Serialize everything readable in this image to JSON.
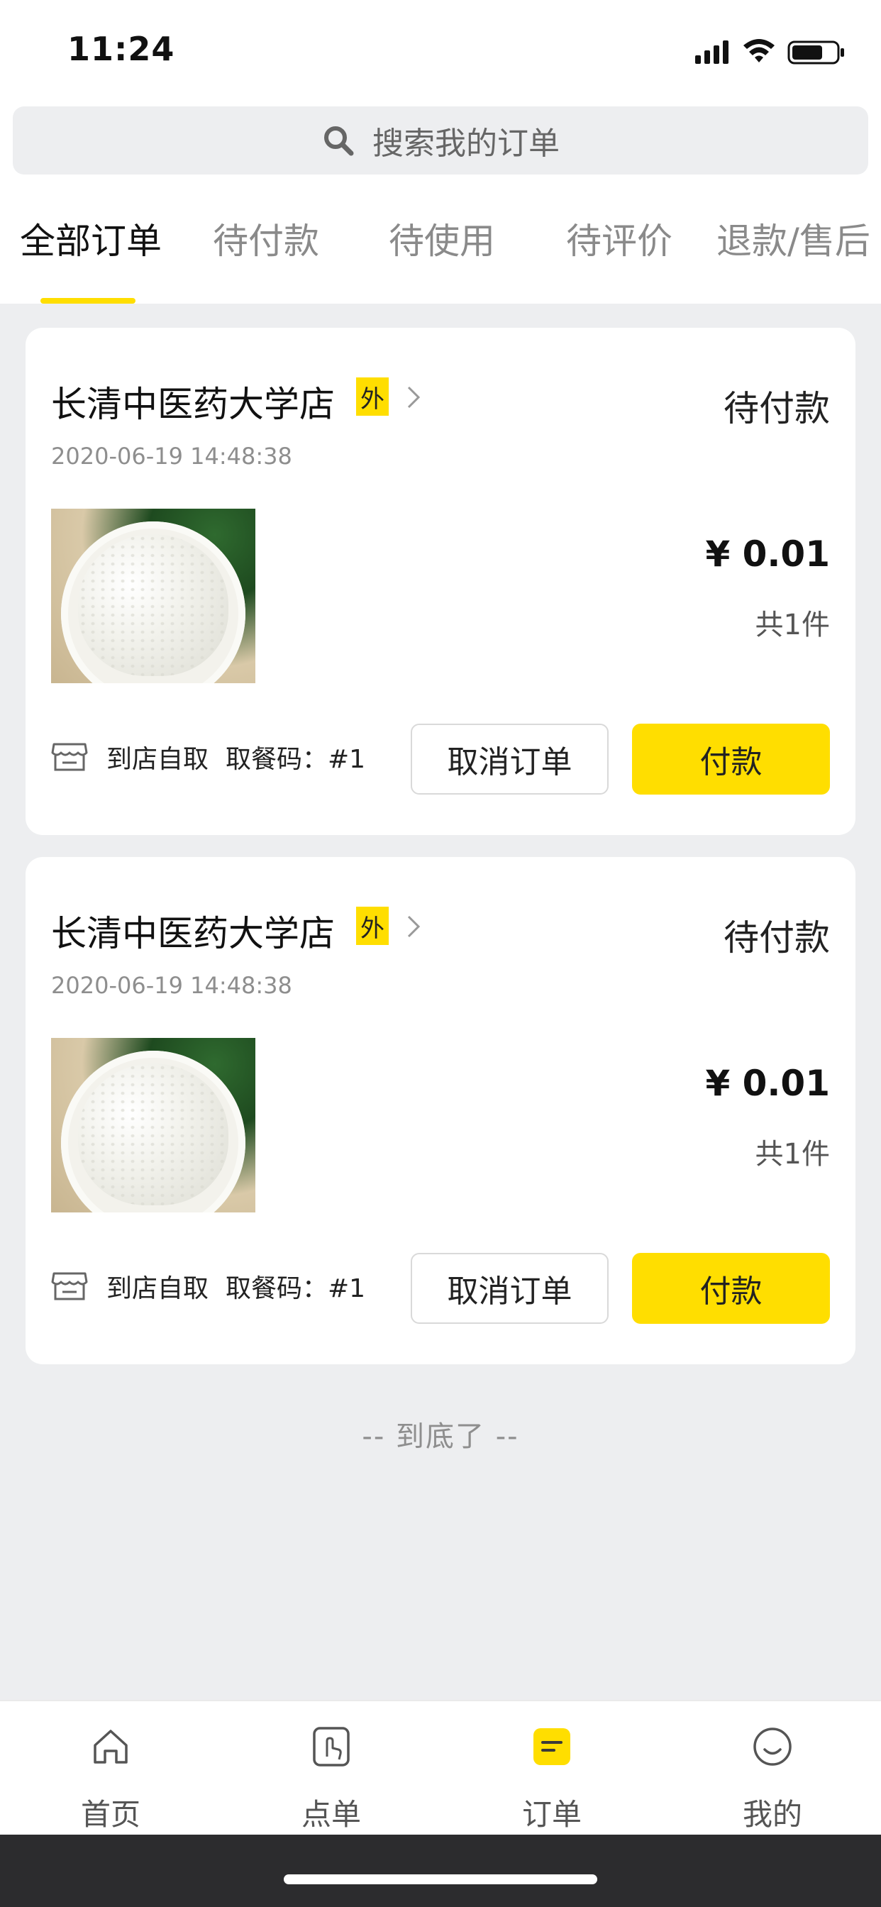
{
  "status_bar": {
    "time": "11:24"
  },
  "search": {
    "placeholder": "搜索我的订单"
  },
  "tabs": [
    {
      "label": "全部订单",
      "active": true
    },
    {
      "label": "待付款",
      "active": false
    },
    {
      "label": "待使用",
      "active": false
    },
    {
      "label": "待评价",
      "active": false
    },
    {
      "label": "退款/售后",
      "active": false
    }
  ],
  "orders": [
    {
      "store": "长清中医药大学店",
      "badge": "外",
      "status": "待付款",
      "date": "2020-06-19 14:48:38",
      "price": "¥ 0.01",
      "count": "共1件",
      "pickup": "到店自取",
      "code": "取餐码：#1",
      "cancel_label": "取消订单",
      "pay_label": "付款"
    },
    {
      "store": "长清中医药大学店",
      "badge": "外",
      "status": "待付款",
      "date": "2020-06-19 14:48:38",
      "price": "¥ 0.01",
      "count": "共1件",
      "pickup": "到店自取",
      "code": "取餐码：#1",
      "cancel_label": "取消订单",
      "pay_label": "付款"
    }
  ],
  "end_text": "-- 到底了 --",
  "bottom_nav": [
    {
      "label": "首页",
      "icon": "home-icon",
      "active": false
    },
    {
      "label": "点单",
      "icon": "order-tap-icon",
      "active": false
    },
    {
      "label": "订单",
      "icon": "orders-icon",
      "active": true
    },
    {
      "label": "我的",
      "icon": "smile-icon",
      "active": false
    }
  ],
  "colors": {
    "accent": "#FFDE00",
    "background": "#EDEEF0"
  }
}
